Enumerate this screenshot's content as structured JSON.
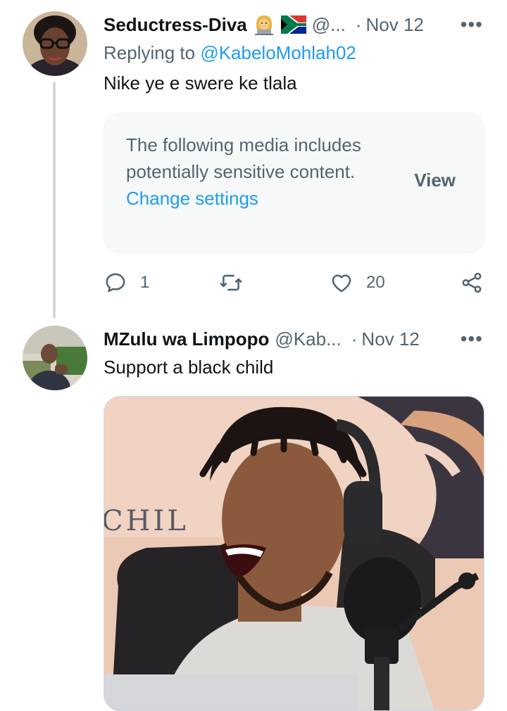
{
  "tweets": [
    {
      "name": "Seductress-Diva",
      "handle": "@...",
      "time": "Nov 12",
      "more": "•••",
      "reply_prefix": "Replying to ",
      "reply_handle": "@KabeloMohlah02",
      "text": "Nike ye e swere ke tlala",
      "sensitive_text": "The following media includes potentially sensitive content.",
      "sensitive_link": "Change settings",
      "view_label": "View",
      "reply_count": "1",
      "like_count": "20",
      "icons": [
        "reply-icon",
        "retweet-icon",
        "like-icon",
        "share-icon"
      ]
    },
    {
      "name": "MZulu wa Limpopo",
      "handle": "@Kab...",
      "time": "Nov 12",
      "more": "•••",
      "text": "Support a black child",
      "media_text": "CHIL"
    }
  ],
  "colors": {
    "link": "#1d9bf0",
    "secondary": "#536471",
    "text": "#0f1419",
    "line": "#cfd9de"
  },
  "separator": "·"
}
